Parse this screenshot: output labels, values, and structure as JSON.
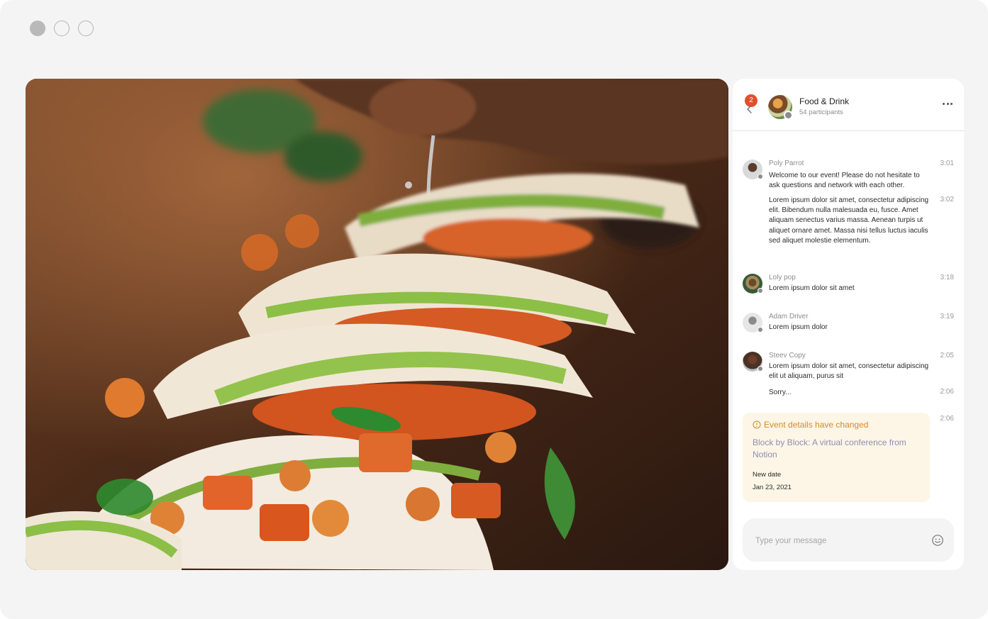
{
  "window": {
    "controls": [
      "close-dot",
      "minimize-dot",
      "maximize-dot"
    ]
  },
  "photo": {
    "subject": "tacos-image"
  },
  "chat": {
    "unread_count": "2",
    "group_title": "Food & Drink",
    "participants": "54 participants",
    "messages": [
      {
        "name": "Poly Parrot",
        "time": "3:01",
        "text": "Welcome to our event! Please do not hesitate to ask questions and network with each other."
      },
      {
        "name": "",
        "time": "3:02",
        "text": "Lorem ipsum dolor sit amet, consectetur adipiscing elit. Bibendum nulla malesuada eu, fusce. Amet aliquam senectus varius massa. Aenean turpis ut aliquet ornare amet. Massa nisi tellus luctus iaculis sed aliquet molestie elementum."
      },
      {
        "name": "Loly pop",
        "time": "3:18",
        "text": "Lorem ipsum dolor sit amet"
      },
      {
        "name": "Adam Driver",
        "time": "3:19",
        "text": "Lorem ipsum dolor"
      },
      {
        "name": "Steev Copy",
        "time": "2:05",
        "text": "Lorem ipsum dolor sit amet, consectetur adipiscing elit ut aliquam, purus sit"
      },
      {
        "name": "",
        "time": "2:06",
        "text": "Sorry..."
      }
    ],
    "event": {
      "time": "2:06",
      "heading": "Event details have changed",
      "title": "Block by Block: A virtual conference from Notion",
      "label": "New date",
      "date": "Jan 23, 2021"
    },
    "composer": {
      "placeholder": "Type your message"
    }
  },
  "colors": {
    "accent_badge": "#e2502b",
    "event_bg": "#fdf6e7",
    "event_heading": "#d7882a"
  }
}
